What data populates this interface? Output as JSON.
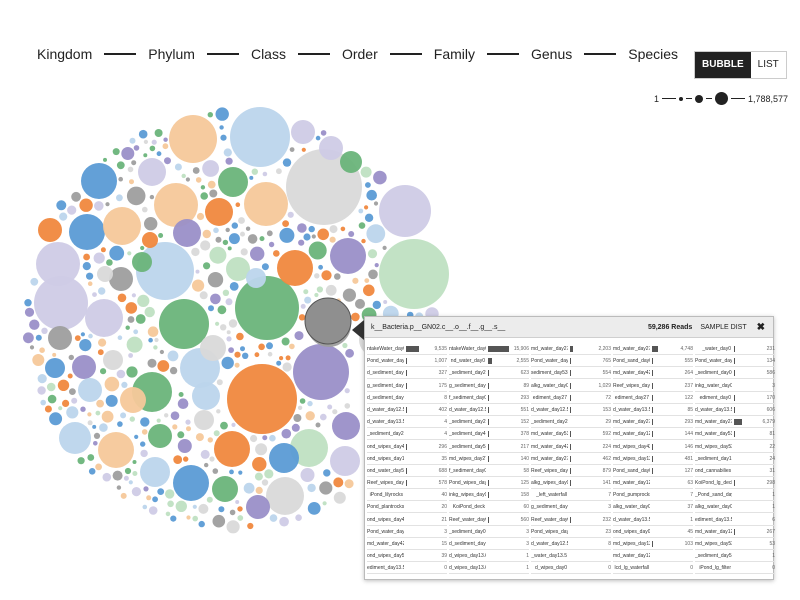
{
  "breadcrumbs": [
    "Kingdom",
    "Phylum",
    "Class",
    "Order",
    "Family",
    "Genus",
    "Species"
  ],
  "view_toggle": {
    "bubble": "BUBBLE",
    "list": "LIST",
    "active": "bubble"
  },
  "size_legend": {
    "min": "1",
    "max": "1,788,577"
  },
  "colors": {
    "blue": "#5b9bd5",
    "orange": "#f0883e",
    "green": "#6ab47a",
    "purple": "#9a8fc8",
    "gray": "#9e9e9e",
    "light_blue": "#bcd5ec",
    "light_orange": "#f6c89a",
    "light_green": "#bfe0c2",
    "light_purple": "#cfcbe6",
    "light_gray": "#d9d9d9",
    "dark": "#222222"
  },
  "tooltip": {
    "name": "k__Bacteria.p__GN02.c__.o__.f__.g__.s__",
    "reads": "59,286 Reads",
    "dist_label": "SAMPLE DIST",
    "samples": [
      {
        "name": "ntakeWater_day0",
        "reads": "9,535",
        "fraction": 0.62
      },
      {
        "name": "ntakeWater_day0",
        "reads": "15,906",
        "fraction": 1.0
      },
      {
        "name": "md_water_day27",
        "reads": "2,203",
        "fraction": 0.15
      },
      {
        "name": "md_water_day27",
        "reads": "4,748",
        "fraction": 0.3
      },
      {
        "name": "_water_day0",
        "reads": "231",
        "fraction": 0.02
      },
      {
        "name": "Pond_water_day0",
        "reads": "1,007",
        "fraction": 0.07
      },
      {
        "name": "nd_water_day0",
        "reads": "2,555",
        "fraction": 0.17
      },
      {
        "name": "Pond_water_day0",
        "reads": "765",
        "fraction": 0.05
      },
      {
        "name": "Pond_sand_day0",
        "reads": "555",
        "fraction": 0.04
      },
      {
        "name": "Pond_water_day0",
        "reads": "134",
        "fraction": 0.01
      },
      {
        "name": "d_sediment_day0",
        "reads": "327",
        "fraction": 0.02
      },
      {
        "name": "_sediment_day27",
        "reads": "623",
        "fraction": 0.04
      },
      {
        "name": "sediment_day53",
        "reads": "554",
        "fraction": 0.04
      },
      {
        "name": "md_water_day42",
        "reads": "264",
        "fraction": 0.02
      },
      {
        "name": "_sediment_day0",
        "reads": "586",
        "fraction": 0.04
      },
      {
        "name": "g_sediment_day0",
        "reads": "175",
        "fraction": 0.01
      },
      {
        "name": "g_sediment_day0",
        "reads": "89",
        "fraction": 0.01
      },
      {
        "name": "alkg_water_day0",
        "reads": "1,029",
        "fraction": 0.07
      },
      {
        "name": "Reef_wipes_day0",
        "reads": "237",
        "fraction": 0.02
      },
      {
        "name": "inkg_water_day0",
        "reads": "3",
        "fraction": 0.0
      },
      {
        "name": "d_sediment_day0",
        "reads": "8",
        "fraction": 0.0
      },
      {
        "name": "f_sediment_day0",
        "reads": "293",
        "fraction": 0.02
      },
      {
        "name": "ediment_day27",
        "reads": "72",
        "fraction": 0.01
      },
      {
        "name": "ediment_day27",
        "reads": "122",
        "fraction": 0.01
      },
      {
        "name": "ediment_day0",
        "reads": "170",
        "fraction": 0.01
      },
      {
        "name": "d_water_day12.5",
        "reads": "402",
        "fraction": 0.03
      },
      {
        "name": "d_water_day12.5",
        "reads": "551",
        "fraction": 0.04
      },
      {
        "name": "d_water_day12.5",
        "reads": "153",
        "fraction": 0.01
      },
      {
        "name": "d_water_day13.5",
        "reads": "85",
        "fraction": 0.01
      },
      {
        "name": "d_water_day13.5",
        "reads": "606",
        "fraction": 0.04
      },
      {
        "name": "d_water_day13.5",
        "reads": "4",
        "fraction": 0.0
      },
      {
        "name": "_sediment_day27",
        "reads": "152",
        "fraction": 0.01
      },
      {
        "name": "_sediment_day27",
        "reads": "29",
        "fraction": 0.0
      },
      {
        "name": "md_water_day27",
        "reads": "293",
        "fraction": 0.02
      },
      {
        "name": "md_water_day27",
        "reads": "6,379",
        "fraction": 0.4
      },
      {
        "name": "_sediment_day27",
        "reads": "4",
        "fraction": 0.0
      },
      {
        "name": "_sediment_day42",
        "reads": "378",
        "fraction": 0.02
      },
      {
        "name": "md_water_day53",
        "reads": "592",
        "fraction": 0.04
      },
      {
        "name": "md_water_day12",
        "reads": "144",
        "fraction": 0.01
      },
      {
        "name": "md_water_day53",
        "reads": "81",
        "fraction": 0.01
      },
      {
        "name": "ond_wipes_day42",
        "reads": "296",
        "fraction": 0.02
      },
      {
        "name": "_sediment_day53",
        "reads": "217",
        "fraction": 0.01
      },
      {
        "name": "md_water_day42",
        "reads": "224",
        "fraction": 0.01
      },
      {
        "name": "md_wipes_day42",
        "reads": "146",
        "fraction": 0.01
      },
      {
        "name": "md_wipes_day53",
        "reads": "22",
        "fraction": 0.0
      },
      {
        "name": "ond_wipes_day12",
        "reads": "35",
        "fraction": 0.0
      },
      {
        "name": "md_wipes_day27",
        "reads": "140",
        "fraction": 0.01
      },
      {
        "name": "md_water_day27",
        "reads": "462",
        "fraction": 0.03
      },
      {
        "name": "md_wipes_day12",
        "reads": "481",
        "fraction": 0.03
      },
      {
        "name": "_sediment_day12",
        "reads": "24",
        "fraction": 0.0
      },
      {
        "name": "ond_water_day53",
        "reads": "688",
        "fraction": 0.04
      },
      {
        "name": "f_sediment_day0",
        "reads": "58",
        "fraction": 0.0
      },
      {
        "name": "Reef_wipes_day0",
        "reads": "879",
        "fraction": 0.06
      },
      {
        "name": "Pond_sand_day0",
        "reads": "127",
        "fraction": 0.01
      },
      {
        "name": "ond_cannabilies",
        "reads": "31",
        "fraction": 0.0
      },
      {
        "name": "Reef_wipes_day0",
        "reads": "578",
        "fraction": 0.04
      },
      {
        "name": "Pond_wipes_day0",
        "reads": "125",
        "fraction": 0.01
      },
      {
        "name": "alkg_wipes_day0",
        "reads": "141",
        "fraction": 0.01
      },
      {
        "name": "md_water_day12",
        "reads": "63",
        "fraction": 0.0
      },
      {
        "name": "KoiPond_lg_deck",
        "reads": "298",
        "fraction": 0.02
      },
      {
        "name": "iPond_lilyrocks",
        "reads": "40",
        "fraction": 0.0
      },
      {
        "name": "inkg_wipes_day0",
        "reads": "158",
        "fraction": 0.01
      },
      {
        "name": "_left_waterfall",
        "reads": "7",
        "fraction": 0.0
      },
      {
        "name": "Pond_pumprocks",
        "reads": "7",
        "fraction": 0.0
      },
      {
        "name": "_Pond_sand_day0",
        "reads": "1",
        "fraction": 0.0
      },
      {
        "name": "Pond_plantrocks",
        "reads": "20",
        "fraction": 0.0
      },
      {
        "name": "KoiPond_deck",
        "reads": "60",
        "fraction": 0.0
      },
      {
        "name": "g_sediment_day0",
        "reads": "3",
        "fraction": 0.0
      },
      {
        "name": "alkg_water_day0",
        "reads": "37",
        "fraction": 0.0
      },
      {
        "name": "alkg_water_day0",
        "reads": "1",
        "fraction": 0.0
      },
      {
        "name": "ond_wipes_day42",
        "reads": "21",
        "fraction": 0.0
      },
      {
        "name": "Reef_water_day0",
        "reads": "560",
        "fraction": 0.04
      },
      {
        "name": "Reef_water_day0",
        "reads": "232",
        "fraction": 0.02
      },
      {
        "name": "d_water_day13.5",
        "reads": "1",
        "fraction": 0.0
      },
      {
        "name": "ediment_day13.5",
        "reads": "6",
        "fraction": 0.0
      },
      {
        "name": "Pond_water_day0",
        "reads": "3",
        "fraction": 0.0
      },
      {
        "name": "_sediment_day0",
        "reads": "3",
        "fraction": 0.0
      },
      {
        "name": "Pond_wipes_day0",
        "reads": "23",
        "fraction": 0.0
      },
      {
        "name": "ond_wipes_day0",
        "reads": "45",
        "fraction": 0.0
      },
      {
        "name": "md_water_day12",
        "reads": "267",
        "fraction": 0.02
      },
      {
        "name": "md_water_day42",
        "reads": "15",
        "fraction": 0.0
      },
      {
        "name": "d_sediment_day0",
        "reads": "3",
        "fraction": 0.0
      },
      {
        "name": "d_water_day12.5",
        "reads": "8",
        "fraction": 0.0
      },
      {
        "name": "md_wipes_day12.5",
        "reads": "103",
        "fraction": 0.01
      },
      {
        "name": "md_wipes_day53",
        "reads": "53",
        "fraction": 0.0
      },
      {
        "name": "ond_wipes_day53",
        "reads": "39",
        "fraction": 0.0
      },
      {
        "name": "d_wipes_day13.6",
        "reads": "1",
        "fraction": 0.0
      },
      {
        "name": "_water_day13.5",
        "reads": "",
        "fraction": 0.0
      },
      {
        "name": "md_water_day12",
        "reads": "",
        "fraction": 0.0
      },
      {
        "name": "_sediment_day53",
        "reads": "1",
        "fraction": 0.0
      },
      {
        "name": "ediment_day13.5",
        "reads": "0",
        "fraction": 0.0
      },
      {
        "name": "d_wipes_day13.6",
        "reads": "1",
        "fraction": 0.0
      },
      {
        "name": "d_wipes_day0",
        "reads": "0",
        "fraction": 0.0
      },
      {
        "name": "lcd_lg_waterfall",
        "reads": "0",
        "fraction": 0.0
      },
      {
        "name": "iPond_lg_filter",
        "reads": "0",
        "fraction": 0.0
      }
    ]
  }
}
